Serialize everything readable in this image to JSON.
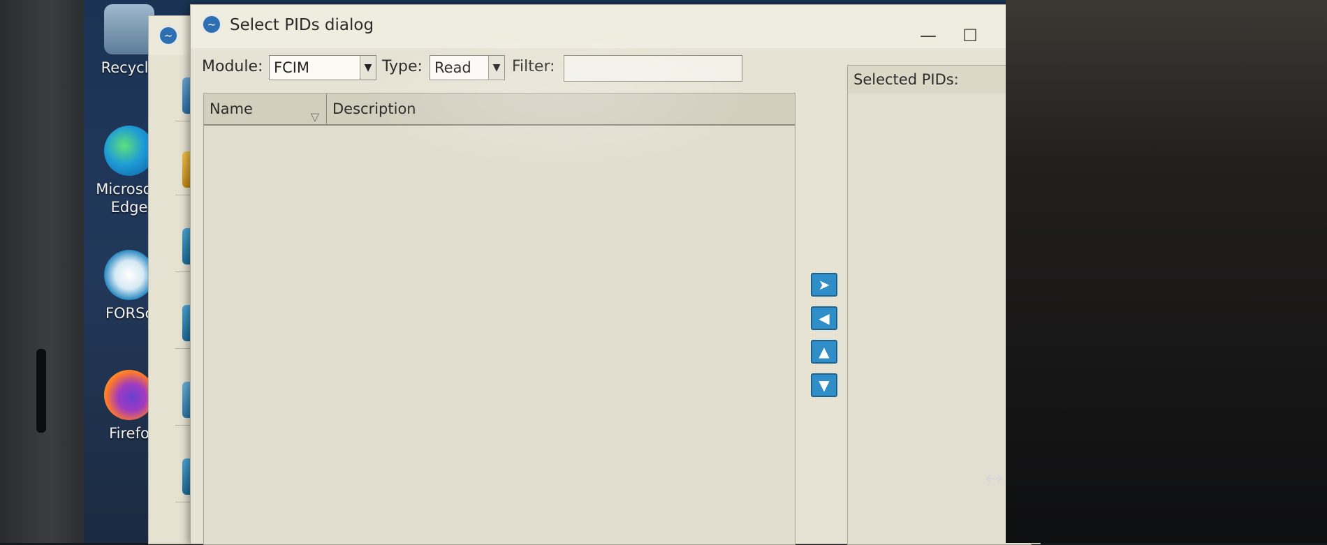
{
  "desktop": {
    "icons": [
      {
        "label": "Recycle",
        "icon": "recycle-bin-icon"
      },
      {
        "label": "Microsoft Edge",
        "icon": "edge-icon"
      },
      {
        "label": "FORSc",
        "icon": "forscan-icon"
      },
      {
        "label": "Firefo",
        "icon": "firefox-icon"
      }
    ]
  },
  "dialog": {
    "title": "Select PIDs dialog",
    "module_label": "Module:",
    "module_value": "FCIM",
    "type_label": "Type:",
    "type_value": "Read",
    "filter_label": "Filter:",
    "filter_value": "",
    "columns": [
      "Name",
      "Description"
    ],
    "selected_title": "Selected PIDs:",
    "move_buttons": [
      {
        "glyph": "➤",
        "icon": "arrow-right-icon"
      },
      {
        "glyph": "◀",
        "icon": "arrow-left-icon"
      },
      {
        "glyph": "▲",
        "icon": "arrow-up-icon"
      },
      {
        "glyph": "▼",
        "icon": "arrow-down-icon"
      }
    ]
  },
  "colors": {
    "accent": "#2f8ec7",
    "dialog_bg": "#e7e3d4"
  }
}
